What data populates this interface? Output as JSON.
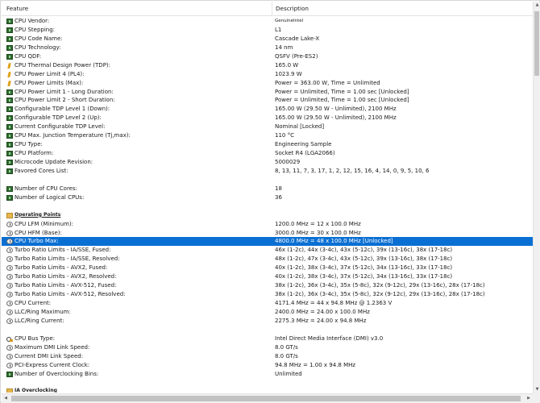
{
  "header": {
    "feature": "Feature",
    "description": "Description"
  },
  "rows": [
    {
      "icon": "chip-icon",
      "feature": "CPU Vendor:",
      "desc": "GenuineIntel",
      "small": true
    },
    {
      "icon": "chip-icon",
      "feature": "CPU Stepping:",
      "desc": "L1"
    },
    {
      "icon": "chip-icon",
      "feature": "CPU Code Name:",
      "desc": "Cascade Lake-X"
    },
    {
      "icon": "chip-icon",
      "feature": "CPU Technology:",
      "desc": "14 nm"
    },
    {
      "icon": "chip-icon",
      "feature": "CPU QDF:",
      "desc": "QSFV (Pre-ES2)"
    },
    {
      "icon": "flame-icon",
      "feature": "CPU Thermal Design Power (TDP):",
      "desc": "165.0 W"
    },
    {
      "icon": "flame-icon",
      "feature": "CPU Power Limit 4 (PL4):",
      "desc": "1023.9 W"
    },
    {
      "icon": "flame-icon",
      "feature": "CPU Power Limits (Max):",
      "desc": "Power = 363.00 W, Time = Unlimited"
    },
    {
      "icon": "chip-icon",
      "feature": "CPU Power Limit 1 - Long Duration:",
      "desc": "Power = Unlimited, Time = 1.00 sec [Unlocked]"
    },
    {
      "icon": "chip-icon",
      "feature": "CPU Power Limit 2 - Short Duration:",
      "desc": "Power = Unlimited, Time = 1.00 sec [Unlocked]"
    },
    {
      "icon": "chip-icon",
      "feature": "Configurable TDP Level 1 (Down):",
      "desc": "165.00 W (29.50 W - Unlimited), 2100 MHz"
    },
    {
      "icon": "chip-icon",
      "feature": "Configurable TDP Level 2 (Up):",
      "desc": "165.00 W (29.50 W - Unlimited), 2100 MHz"
    },
    {
      "icon": "chip-icon",
      "feature": "Current Configurable TDP Level:",
      "desc": "Nominal [Locked]"
    },
    {
      "icon": "chip-icon",
      "feature": "CPU Max. Junction Temperature (Tj,max):",
      "desc": "110 °C"
    },
    {
      "icon": "chip-icon",
      "feature": "CPU Type:",
      "desc": "Engineering Sample"
    },
    {
      "icon": "chip-icon",
      "feature": "CPU Platform:",
      "desc": "Socket R4 (LGA2066)"
    },
    {
      "icon": "chip-icon",
      "feature": "Microcode Update Revision:",
      "desc": "5000029"
    },
    {
      "icon": "chip-icon",
      "feature": "Favored Cores List:",
      "desc": "8, 13, 11, 7, 3, 17, 1, 2, 12, 15, 16, 4, 14, 0, 9, 5, 10, 6"
    },
    {
      "icon": "",
      "feature": "",
      "desc": ""
    },
    {
      "icon": "chip-icon",
      "feature": "Number of CPU Cores:",
      "desc": "18"
    },
    {
      "icon": "chip-icon",
      "feature": "Number of Logical CPUs:",
      "desc": "36"
    },
    {
      "icon": "",
      "feature": "",
      "desc": ""
    },
    {
      "icon": "folder-icon",
      "feature": "Operating Points",
      "desc": "",
      "section": true
    },
    {
      "icon": "clock-icon",
      "feature": "CPU LFM (Minimum):",
      "desc": "1200.0 MHz = 12 x 100.0 MHz"
    },
    {
      "icon": "clock-icon",
      "feature": "CPU HFM (Base):",
      "desc": "3000.0 MHz = 30 x 100.0 MHz"
    },
    {
      "icon": "clock-icon",
      "feature": "CPU Turbo Max:",
      "desc": "4800.0 MHz = 48 x 100.0 MHz [Unlocked]",
      "selected": true
    },
    {
      "icon": "clock-icon",
      "feature": "Turbo Ratio Limits - IA/SSE, Fused:",
      "desc": "46x (1-2c), 44x (3-4c), 43x (5-12c), 39x (13-16c), 38x (17-18c)"
    },
    {
      "icon": "clock-icon",
      "feature": "Turbo Ratio Limits - IA/SSE, Resolved:",
      "desc": "48x (1-2c), 47x (3-4c), 43x (5-12c), 39x (13-16c), 38x (17-18c)"
    },
    {
      "icon": "clock-icon",
      "feature": "Turbo Ratio Limits - AVX2, Fused:",
      "desc": "40x (1-2c), 38x (3-4c), 37x (5-12c), 34x (13-16c), 33x (17-18c)"
    },
    {
      "icon": "clock-icon",
      "feature": "Turbo Ratio Limits - AVX2, Resolved:",
      "desc": "40x (1-2c), 38x (3-4c), 37x (5-12c), 34x (13-16c), 33x (17-18c)"
    },
    {
      "icon": "clock-icon",
      "feature": "Turbo Ratio Limits - AVX-512, Fused:",
      "desc": "38x (1-2c), 36x (3-4c), 35x (5-8c), 32x (9-12c), 29x (13-16c), 28x (17-18c)"
    },
    {
      "icon": "clock-icon",
      "feature": "Turbo Ratio Limits - AVX-512, Resolved:",
      "desc": "38x (1-2c), 36x (3-4c), 35x (5-8c), 32x (9-12c), 29x (13-16c), 28x (17-18c)"
    },
    {
      "icon": "clock-icon",
      "feature": "CPU Current:",
      "desc": "4171.4 MHz = 44 x 94.8 MHz @ 1.2363 V"
    },
    {
      "icon": "clock-icon",
      "feature": "LLC/Ring Maximum:",
      "desc": "2400.0 MHz = 24.00 x 100.0 MHz"
    },
    {
      "icon": "clock-icon",
      "feature": "LLC/Ring Current:",
      "desc": "2275.3 MHz = 24.00 x 94.8 MHz"
    },
    {
      "icon": "",
      "feature": "",
      "desc": ""
    },
    {
      "icon": "bus-icon",
      "feature": "CPU Bus Type:",
      "desc": "Intel Direct Media Interface (DMI) v3.0"
    },
    {
      "icon": "clock-icon",
      "feature": "Maximum DMI Link Speed:",
      "desc": "8.0 GT/s"
    },
    {
      "icon": "clock-icon",
      "feature": "Current DMI Link Speed:",
      "desc": "8.0 GT/s"
    },
    {
      "icon": "clock-icon",
      "feature": "PCI-Express Current Clock:",
      "desc": "94.8 MHz = 1.00 x 94.8 MHz"
    },
    {
      "icon": "chip-icon",
      "feature": "Number of Overclocking Bins:",
      "desc": "Unlimited"
    },
    {
      "icon": "",
      "feature": "",
      "desc": ""
    },
    {
      "icon": "folder-icon",
      "feature": "IA Overclocking",
      "desc": "",
      "section": true
    }
  ],
  "scroll": {
    "up": "▲",
    "down": "▼",
    "left": "◀",
    "right": "▶"
  },
  "colors": {
    "selection": "#0a6fd3",
    "chip": "#2f6b2f",
    "flame": "#e0a21a"
  }
}
